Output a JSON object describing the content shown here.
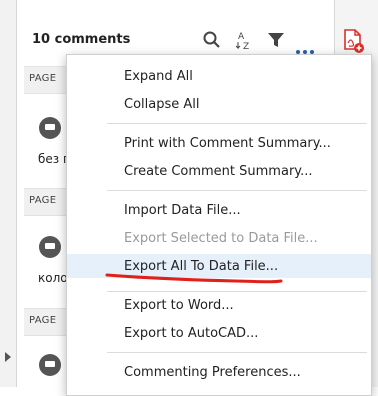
{
  "panel": {
    "comment_count_label": "10 comments",
    "page_labels": [
      "PAGE",
      "PAGE",
      "PAGE"
    ],
    "snippets": [
      "без п",
      "коло"
    ]
  },
  "header_icons": [
    "search-icon",
    "sort-az-icon",
    "filter-icon",
    "more-options-icon"
  ],
  "menu": {
    "items": [
      {
        "label": "Expand All",
        "enabled": true
      },
      {
        "label": "Collapse All",
        "enabled": true
      },
      {
        "label": "Print with Comment Summary...",
        "enabled": true
      },
      {
        "label": "Create Comment Summary...",
        "enabled": true
      },
      {
        "label": "Import Data File...",
        "enabled": true
      },
      {
        "label": "Export Selected to Data File...",
        "enabled": false
      },
      {
        "label": "Export All To Data File...",
        "enabled": true,
        "highlighted": true
      },
      {
        "label": "Export to Word...",
        "enabled": true
      },
      {
        "label": "Export to AutoCAD...",
        "enabled": true
      },
      {
        "label": "Commenting Preferences...",
        "enabled": true
      }
    ]
  },
  "colors": {
    "accent_blue": "#2a5fb0",
    "pdf_red": "#d9302c",
    "annotation_red": "#e0201b",
    "highlight_bg": "#e6f0fb"
  }
}
